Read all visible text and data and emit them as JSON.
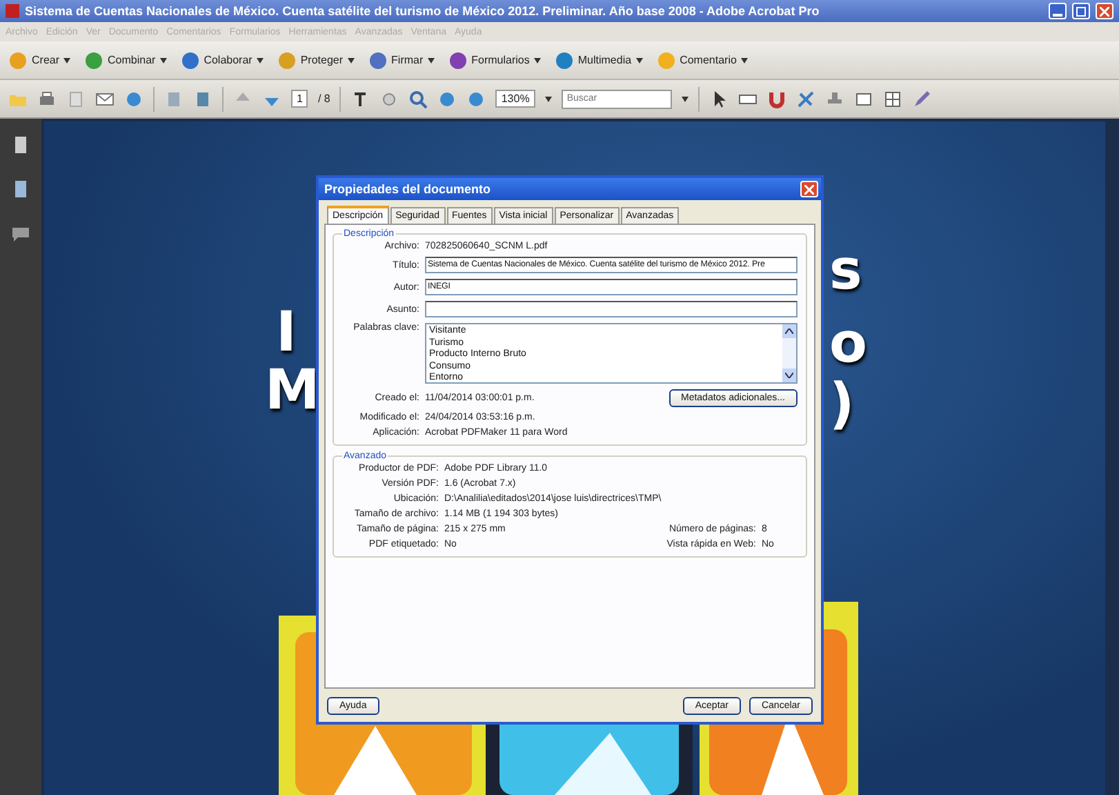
{
  "window": {
    "title": "Sistema de Cuentas Nacionales de México. Cuenta satélite del turismo de México 2012. Preliminar. Año base 2008 - Adobe Acrobat Pro"
  },
  "menu": [
    {
      "label": "Archivo",
      "disabled": true
    },
    {
      "label": "Edición",
      "disabled": true
    },
    {
      "label": "Ver",
      "disabled": true
    },
    {
      "label": "Documento",
      "disabled": true
    },
    {
      "label": "Comentarios",
      "disabled": true
    },
    {
      "label": "Formularios",
      "disabled": true
    },
    {
      "label": "Herramientas",
      "disabled": true
    },
    {
      "label": "Avanzadas",
      "disabled": true
    },
    {
      "label": "Ventana",
      "disabled": true
    },
    {
      "label": "Ayuda",
      "disabled": true
    }
  ],
  "task_buttons": [
    {
      "label": "Crear",
      "color": "#e8a020"
    },
    {
      "label": "Combinar",
      "color": "#3aa040"
    },
    {
      "label": "Colaborar",
      "color": "#3070c8"
    },
    {
      "label": "Proteger",
      "color": "#d8a020"
    },
    {
      "label": "Firmar",
      "color": "#5070c0"
    },
    {
      "label": "Formularios",
      "color": "#8040b0"
    },
    {
      "label": "Multimedia",
      "color": "#2080c0"
    },
    {
      "label": "Comentario",
      "color": "#f0b020"
    }
  ],
  "toolbar": {
    "page_number": "1",
    "page_total": "/ 8",
    "zoom": "130%",
    "search": {
      "placeholder": "Buscar"
    }
  },
  "document": {
    "left_letters": [
      "I",
      "M"
    ],
    "right_letters": [
      "s",
      "o",
      ")"
    ]
  },
  "dialog": {
    "title": "Propiedades del documento",
    "tabs": [
      {
        "label": "Descripción",
        "selected": true
      },
      {
        "label": "Seguridad",
        "selected": false
      },
      {
        "label": "Fuentes",
        "selected": false
      },
      {
        "label": "Vista inicial",
        "selected": false
      },
      {
        "label": "Personalizar",
        "selected": false
      },
      {
        "label": "Avanzadas",
        "selected": false
      }
    ],
    "description": {
      "legend": "Descripción",
      "fields": [
        {
          "kind": "text",
          "label": "Archivo:",
          "value": "702825060640_SCNM L.pdf"
        },
        {
          "kind": "input",
          "label": "Título:",
          "value": "Sistema de Cuentas Nacionales de México. Cuenta satélite del turismo de México 2012. Pre"
        },
        {
          "kind": "input",
          "label": "Autor:",
          "value": "INEGI"
        },
        {
          "kind": "input",
          "label": "Asunto:"
        },
        {
          "kind": "list",
          "label": "Palabras clave:",
          "items": [
            "Visitante",
            "Turismo",
            "Producto Interno Bruto",
            "Consumo",
            "Entorno"
          ]
        }
      ],
      "dates": [
        {
          "label": "Creado el:",
          "value": "11/04/2014 03:00:01 p.m."
        },
        {
          "label": "Modificado el:",
          "value": "24/04/2014 03:53:16 p.m."
        },
        {
          "label": "Aplicación:",
          "value": "Acrobat PDFMaker 11 para Word"
        }
      ],
      "metadata_button": "Metadatos adicionales..."
    },
    "advanced": {
      "legend": "Avanzado",
      "rows": [
        {
          "label": "Productor de PDF:",
          "value": "Adobe PDF Library 11.0"
        },
        {
          "label": "Versión PDF:",
          "value": "1.6 (Acrobat 7.x)"
        },
        {
          "label": "Ubicación:",
          "value": "D:\\Analilia\\editados\\2014\\jose luis\\directrices\\TMP\\"
        },
        {
          "label": "Tamaño de archivo:",
          "value": "1.14 MB (1 194 303 bytes)"
        },
        {
          "label": "Tamaño de página:",
          "value": "215 x 275 mm",
          "extra_label": "Número de páginas:",
          "extra_value": "8"
        },
        {
          "label": "PDF etiquetado:",
          "value": "No",
          "extra_label": "Vista rápida en Web:",
          "extra_value": "No"
        }
      ]
    },
    "buttons": {
      "help": "Ayuda",
      "ok": "Aceptar",
      "cancel": "Cancelar"
    }
  }
}
